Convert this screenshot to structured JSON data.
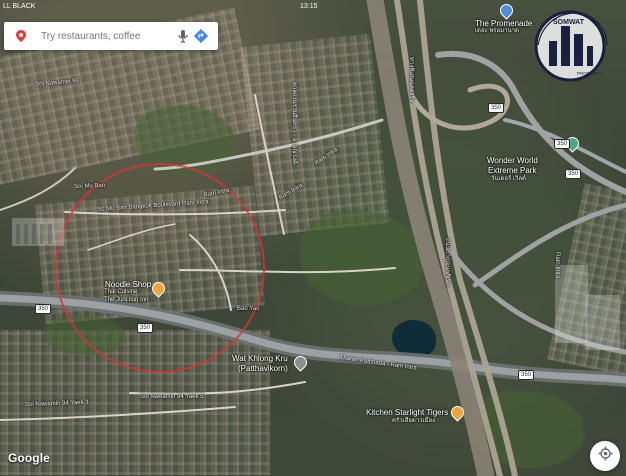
{
  "status_bar": {
    "left": "LL BLACK",
    "time": "13:15"
  },
  "search": {
    "placeholder": "Try restaurants, coffee"
  },
  "watermark": {
    "line1": "SOMWAT",
    "line2": "PROPERTY"
  },
  "labels": {
    "promenade_en": "The Promenade",
    "promenade_th": "เดอะ พรอมานาด",
    "wonder_world_1": "Wonder World",
    "wonder_world_2": "Extreme Park",
    "wonder_world_th": "วันเดอร์ เวิลด์",
    "noodle_1": "Noodle Shop",
    "noodle_2": "Thai Cuisine",
    "noodle_3": "The Junction Inn",
    "temple_1": "Wat Khlong Kru",
    "temple_2": "(Patthavikorn)",
    "kitchen_1": "Kitchen Starlight Tigers",
    "kitchen_th": "ครัวเสือดาวเมือง",
    "road_soi_mu_ban": "So Mu Ban Bangkok Boulevard Ram Intra",
    "road_ram_intra_1": "Ram Intra",
    "road_ram_intra_2": "Ram Intra",
    "road_kalapaphruek": "ถนนกาญจนาภิเษก",
    "road_phra_ram": "ทางด่วนรามอินทรา - อาจณรงค์",
    "road_expressway_upper": "ทางพิเศษฉลองรัช",
    "road_soi_nawamin": "Soi Nawamin 96",
    "road_soi_nawamin_2": "Soi Nawamin 94 Yaek 3",
    "road_soi_nawamin_3": "Soi Nawamin 94 Yaek 5",
    "road_ramintra_tower": "Ram Intra",
    "road_tharon": "Tharon Patchada - Ram Intra",
    "road_uan": "Bao Yao",
    "road_ban": "Soi Mu Ban",
    "road_kha": "Ram Intra",
    "shield_350a": "350",
    "shield_350b": "350",
    "shield_350c": "350",
    "shield_350d": "350",
    "shield_350e": "350",
    "shield_350f": "350"
  },
  "map": {
    "highlight_circle_color": "#d43535",
    "road_color": "#9a9d9f",
    "expressway_color": "#a49a8b",
    "poi_color": "#f2a33a"
  },
  "controls": {
    "google_logo": "Google",
    "locate_icon": "crosshair"
  }
}
